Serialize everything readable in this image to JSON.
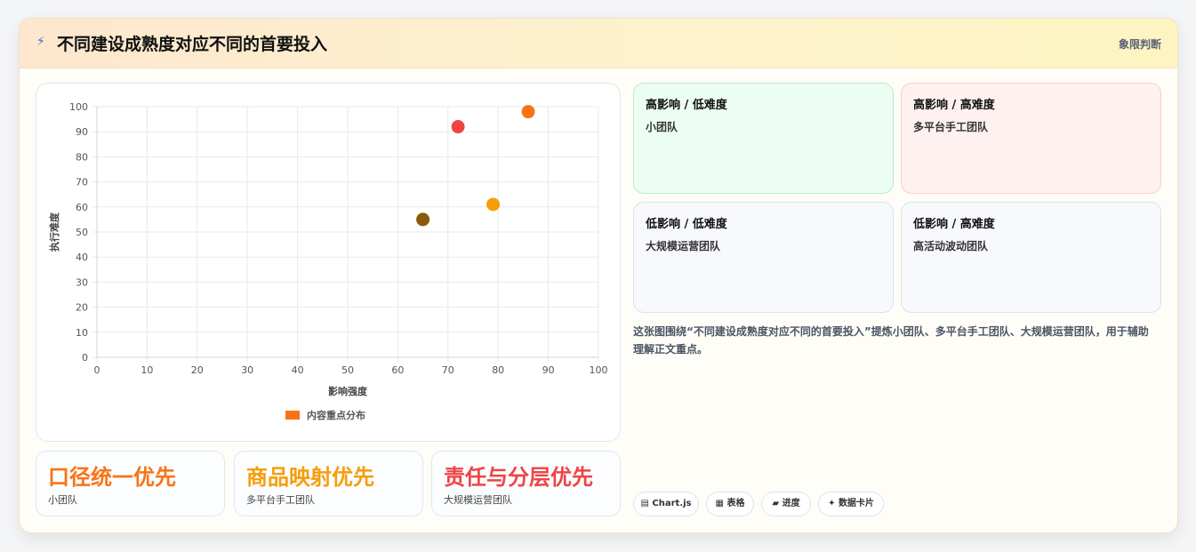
{
  "header": {
    "icon": "⚡",
    "title": "不同建设成熟度对应不同的首要投入",
    "tag": "象限判断"
  },
  "chart_data": {
    "type": "scatter",
    "xlabel": "影响强度",
    "ylabel": "执行难度",
    "xlim": [
      0,
      100
    ],
    "ylim": [
      0,
      100
    ],
    "xticks": [
      0,
      10,
      20,
      30,
      40,
      50,
      60,
      70,
      80,
      90,
      100
    ],
    "yticks": [
      0,
      10,
      20,
      30,
      40,
      50,
      60,
      70,
      80,
      90,
      100
    ],
    "grid": true,
    "legend": {
      "label": "内容重点分布",
      "position": "bottom",
      "color": "#f97316"
    },
    "points": [
      {
        "x": 72,
        "y": 92,
        "color": "#ef4444"
      },
      {
        "x": 86,
        "y": 98,
        "color": "#f97316"
      },
      {
        "x": 65,
        "y": 55,
        "color": "#8a5a0b"
      },
      {
        "x": 79,
        "y": 61,
        "color": "#f59e0b"
      }
    ]
  },
  "quadrants": [
    {
      "title": "高影响 / 低难度",
      "text": "小团队",
      "bg": "#ecfdf3",
      "border": "#b9ecc8"
    },
    {
      "title": "高影响 / 高难度",
      "text": "多平台手工团队",
      "bg": "#fff1f0",
      "border": "#f6cfcb"
    },
    {
      "title": "低影响 / 低难度",
      "text": "大规模运营团队",
      "bg": "#f7f9fc",
      "border": "#d9e2ee"
    },
    {
      "title": "低影响 / 高难度",
      "text": "高活动波动团队",
      "bg": "#f7f9fc",
      "border": "#d9e2ee"
    }
  ],
  "description": "这张图围绕“不同建设成熟度对应不同的首要投入”提炼小团队、多平台手工团队、大规模运营团队，用于辅助理解正文重点。",
  "stats": [
    {
      "big": "口径统一优先",
      "small": "小团队",
      "color": "#f97316"
    },
    {
      "big": "商品映射优先",
      "small": "多平台手工团队",
      "color": "#f59e0b"
    },
    {
      "big": "责任与分层优先",
      "small": "大规模运营团队",
      "color": "#ef4444"
    }
  ],
  "chips": [
    {
      "icon": "▤",
      "label": "Chart.js"
    },
    {
      "icon": "▦",
      "label": "表格"
    },
    {
      "icon": "▰",
      "label": "进度"
    },
    {
      "icon": "✦",
      "label": "数据卡片"
    }
  ]
}
